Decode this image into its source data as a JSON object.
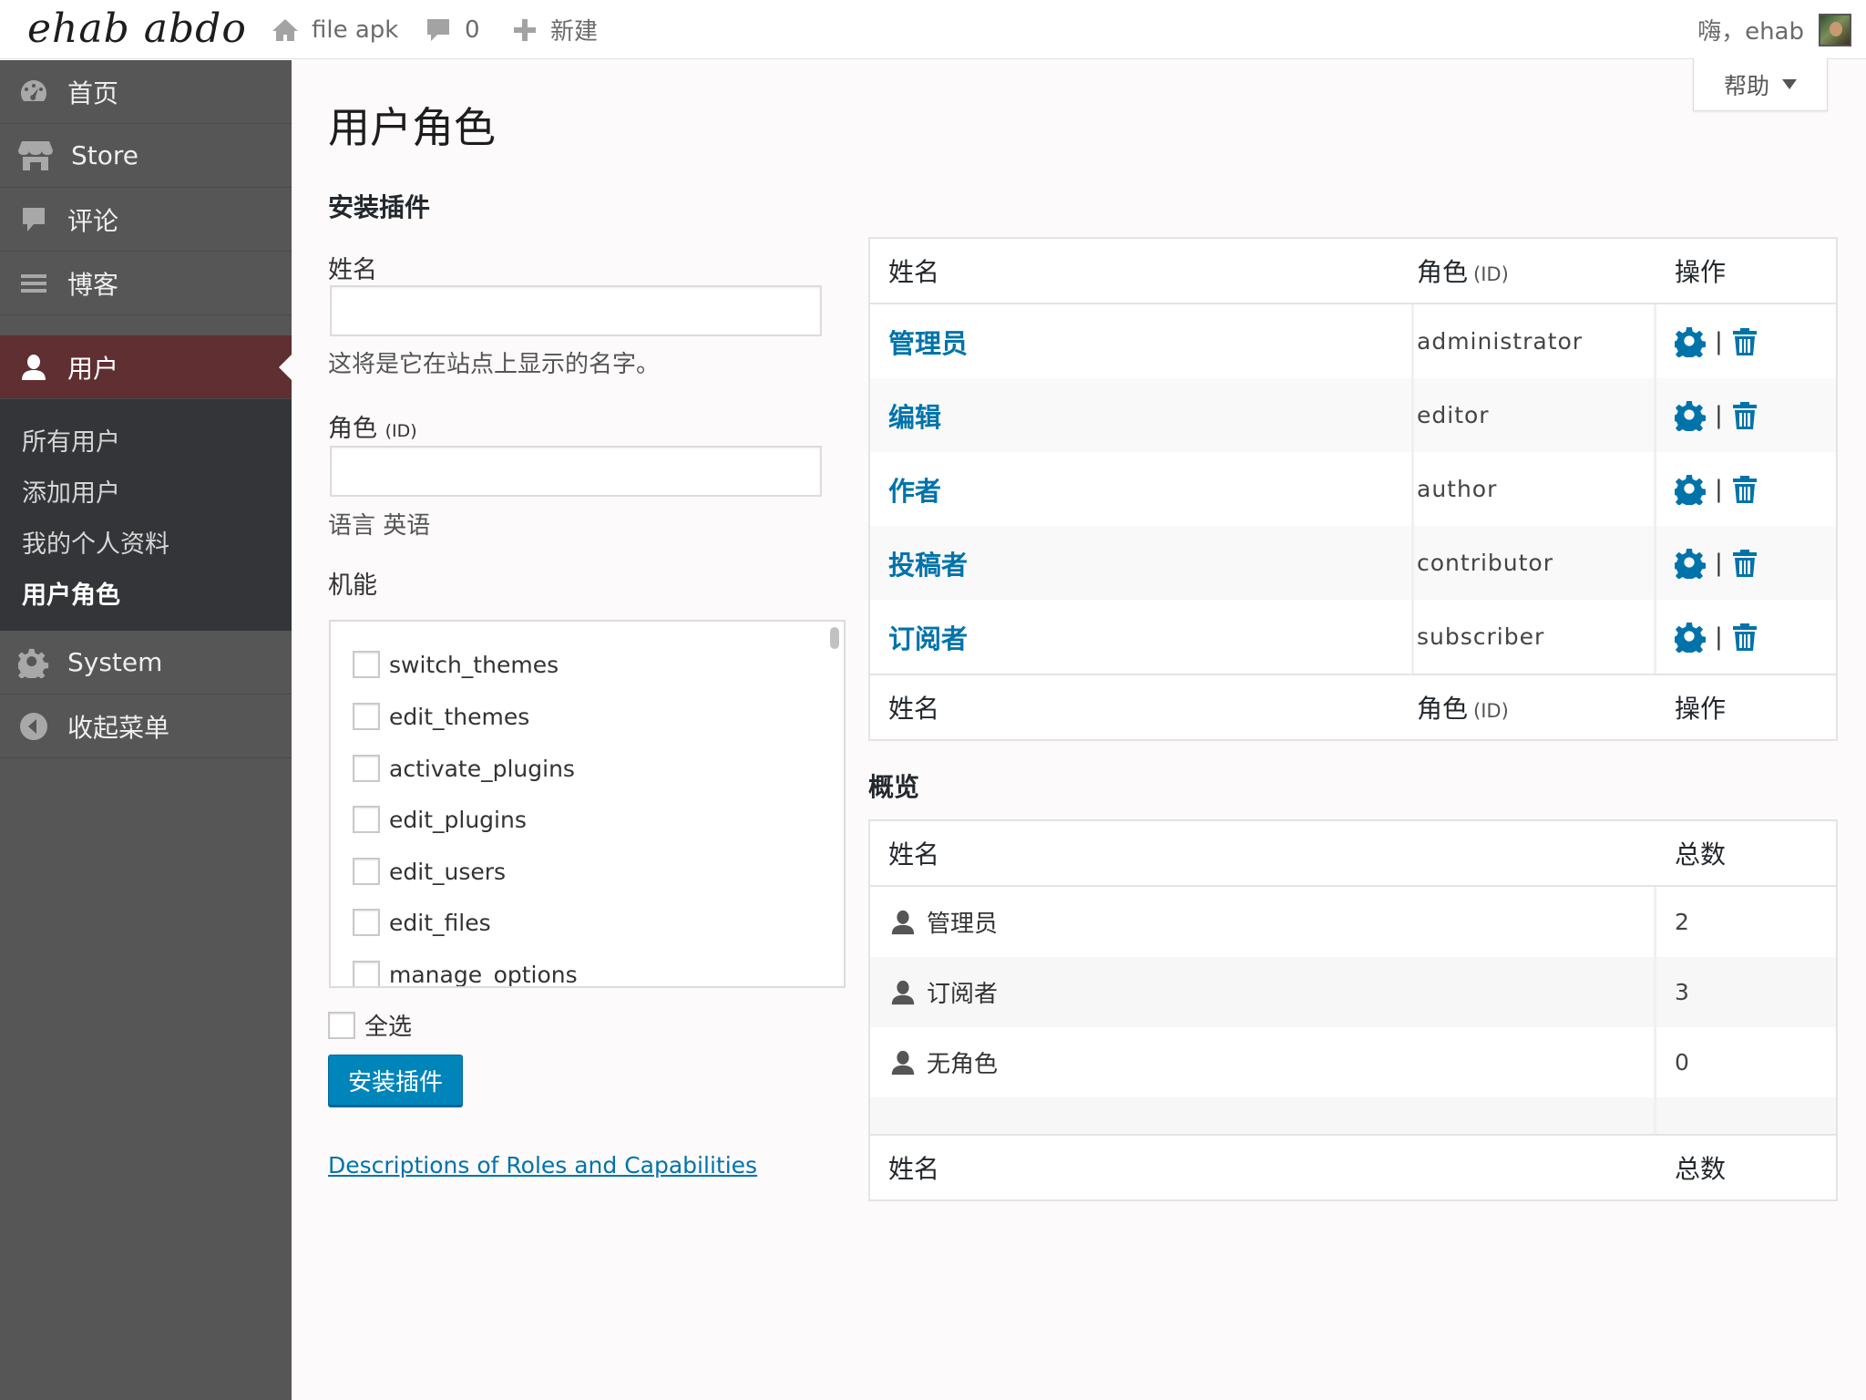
{
  "topbar": {
    "site_title": "ehab abdo",
    "home_label": "file apk",
    "comments_count": "0",
    "new_label": "新建",
    "greeting": "嗨，ehab"
  },
  "sidebar": {
    "items": [
      {
        "label": "首页",
        "icon": "dashboard-icon"
      },
      {
        "label": "Store",
        "icon": "store-icon"
      },
      {
        "label": "评论",
        "icon": "comment-icon"
      },
      {
        "label": "博客",
        "icon": "menu-lines-icon"
      }
    ],
    "active": {
      "label": "用户",
      "icon": "user-icon"
    },
    "submenu": [
      "所有用户",
      "添加用户",
      "我的个人资料",
      "用户角色"
    ],
    "system_label": "System",
    "collapse_label": "收起菜单"
  },
  "help_label": "帮助",
  "page_title": "用户角色",
  "form": {
    "section_title": "安装插件",
    "name_label": "姓名",
    "name_value": "",
    "name_help": "这将是它在站点上显示的名字。",
    "role_label": "角色",
    "role_label_suffix": "(ID)",
    "role_value": "",
    "language_text": "语言 英语",
    "caps_label": "机能",
    "capabilities": [
      "switch_themes",
      "edit_themes",
      "activate_plugins",
      "edit_plugins",
      "edit_users",
      "edit_files",
      "manage_options"
    ],
    "select_all_label": "全选",
    "submit_label": "安装插件",
    "link_text": "Descriptions of Roles and Capabilities"
  },
  "roles_table": {
    "col_name": "姓名",
    "col_role": "角色",
    "col_role_suffix": "(ID)",
    "col_actions": "操作",
    "separator": "|",
    "rows": [
      {
        "name": "管理员",
        "id": "administrator"
      },
      {
        "name": "编辑",
        "id": "editor"
      },
      {
        "name": "作者",
        "id": "author"
      },
      {
        "name": "投稿者",
        "id": "contributor"
      },
      {
        "name": "订阅者",
        "id": "subscriber"
      }
    ]
  },
  "overview": {
    "title": "概览",
    "col_name": "姓名",
    "col_total": "总数",
    "rows": [
      {
        "name": "管理员",
        "count": "2"
      },
      {
        "name": "订阅者",
        "count": "3"
      },
      {
        "name": "无角色",
        "count": "0"
      }
    ]
  },
  "colors": {
    "accent": "#0073aa",
    "button": "#0085ba",
    "sidebar": "#565656",
    "sidebar_active": "#5f2f31",
    "submenu": "#333538"
  }
}
